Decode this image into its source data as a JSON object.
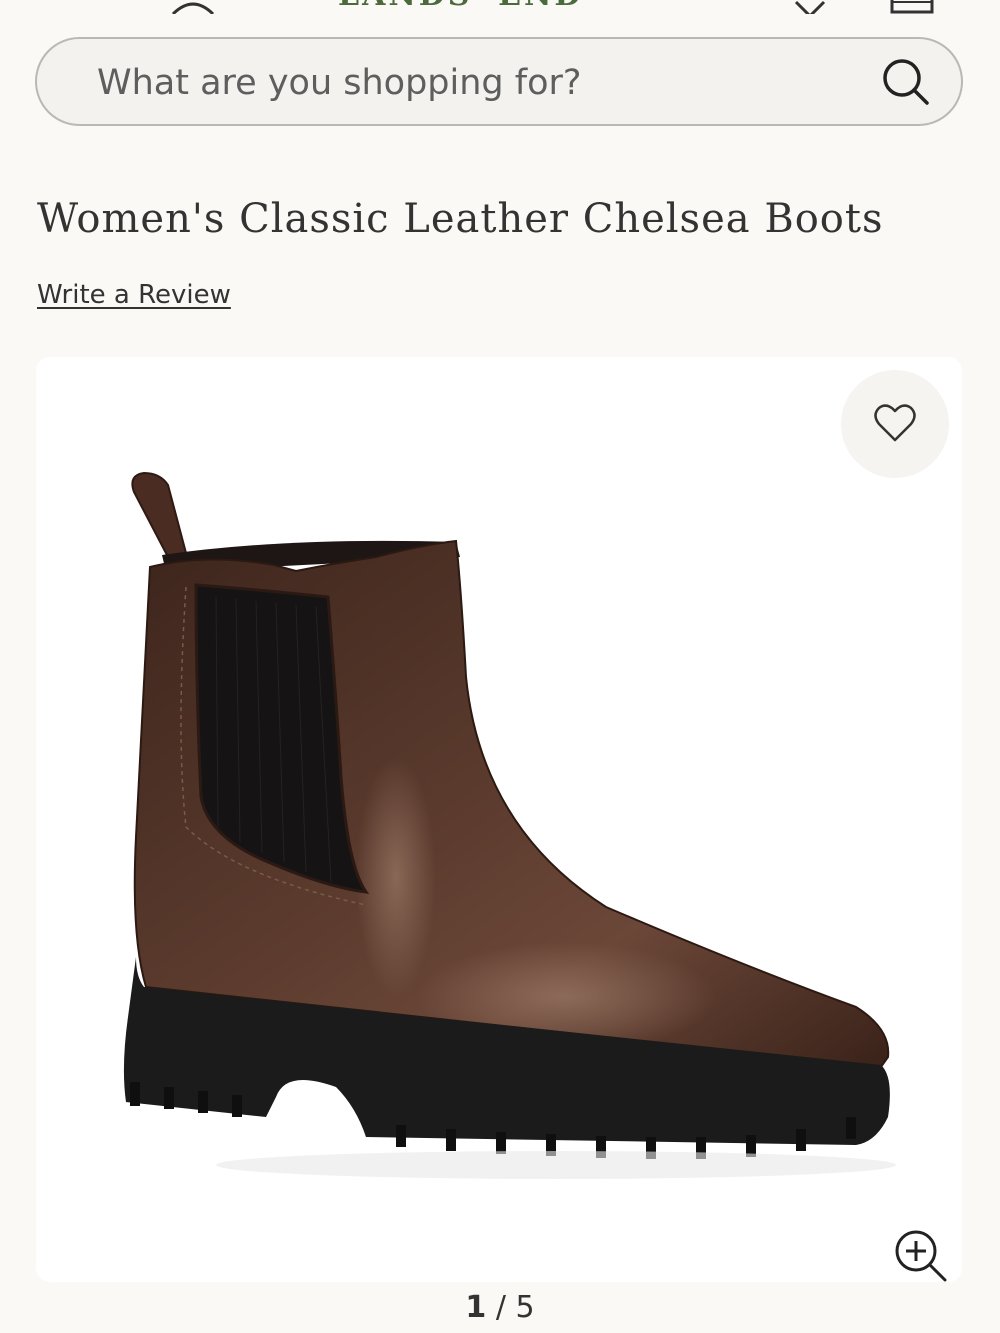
{
  "header": {
    "logo": "LANDS' END",
    "icons": [
      "account-icon",
      "heart-icon",
      "cart-icon"
    ]
  },
  "search": {
    "placeholder": "What are you shopping for?"
  },
  "product": {
    "title": "Women's Classic Leather Chelsea Boots",
    "review_link": "Write a Review"
  },
  "gallery": {
    "current": "1",
    "separator": "/",
    "total": "5"
  },
  "colors": {
    "background": "#faf9f6",
    "logo": "#4b6b3c",
    "text": "#333333",
    "boot_leather": "#4a2f24",
    "boot_sole": "#1c1c1c"
  }
}
